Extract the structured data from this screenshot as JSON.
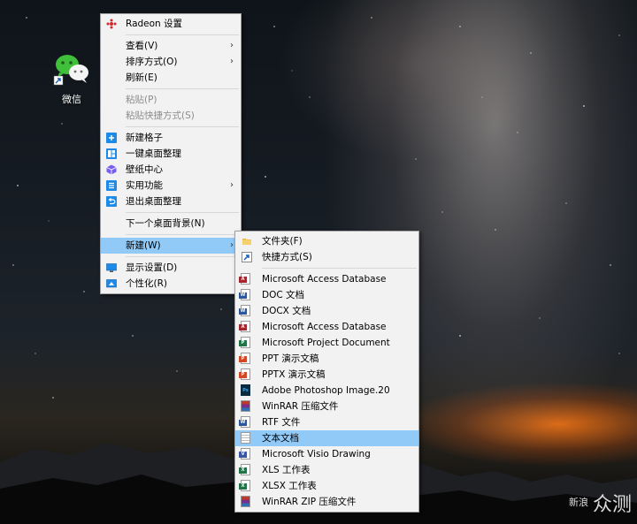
{
  "desktop": {
    "wechat_label": "微信"
  },
  "context_menu": {
    "radeon": "Radeon 设置",
    "view": "查看(V)",
    "sort": "排序方式(O)",
    "refresh": "刷新(E)",
    "paste": "粘贴(P)",
    "paste_shortcut": "粘贴快捷方式(S)",
    "new_grid": "新建格子",
    "one_click_organize": "一键桌面整理",
    "wallpaper_center": "壁纸中心",
    "utilities": "实用功能",
    "exit_organize": "退出桌面整理",
    "next_background": "下一个桌面背景(N)",
    "new": "新建(W)",
    "display_settings": "显示设置(D)",
    "personalize": "个性化(R)"
  },
  "new_submenu": {
    "items": [
      {
        "label": "文件夹(F)",
        "icon": "folder-icon"
      },
      {
        "label": "快捷方式(S)",
        "icon": "shortcut-icon"
      },
      {
        "label": "Microsoft Access Database",
        "icon": "access-icon",
        "color": "#a4262c"
      },
      {
        "label": "DOC 文档",
        "icon": "doc-icon",
        "color": "#2b579a"
      },
      {
        "label": "DOCX 文档",
        "icon": "docx-icon",
        "color": "#2b579a"
      },
      {
        "label": "Microsoft Access Database",
        "icon": "access-icon",
        "color": "#a4262c"
      },
      {
        "label": "Microsoft Project Document",
        "icon": "project-icon",
        "color": "#217346"
      },
      {
        "label": "PPT 演示文稿",
        "icon": "ppt-icon",
        "color": "#d24726"
      },
      {
        "label": "PPTX 演示文稿",
        "icon": "pptx-icon",
        "color": "#d24726"
      },
      {
        "label": "Adobe Photoshop Image.20",
        "icon": "photoshop-icon",
        "color": "#0b2a3d"
      },
      {
        "label": "WinRAR 压缩文件",
        "icon": "winrar-icon",
        "color": "#7a2d8c"
      },
      {
        "label": "RTF 文件",
        "icon": "rtf-icon",
        "color": "#2b579a"
      },
      {
        "label": "文本文档",
        "icon": "text-file-icon",
        "color": "#888888"
      },
      {
        "label": "Microsoft Visio Drawing",
        "icon": "visio-icon",
        "color": "#3955a3"
      },
      {
        "label": "XLS 工作表",
        "icon": "xls-icon",
        "color": "#217346"
      },
      {
        "label": "XLSX 工作表",
        "icon": "xlsx-icon",
        "color": "#217346"
      },
      {
        "label": "WinRAR ZIP 压缩文件",
        "icon": "winrar-zip-icon",
        "color": "#7a2d8c"
      }
    ]
  },
  "watermark": {
    "small": "新浪",
    "big": "众测"
  }
}
